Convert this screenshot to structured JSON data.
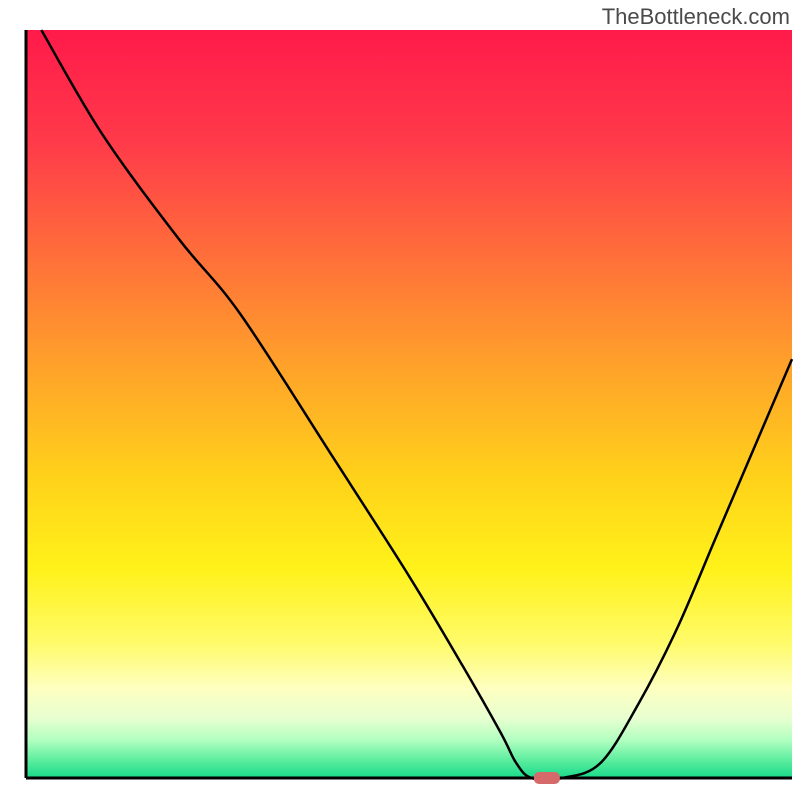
{
  "watermark": "TheBottleneck.com",
  "chart_data": {
    "type": "line",
    "title": "",
    "xlabel": "",
    "ylabel": "",
    "xlim": [
      0,
      100
    ],
    "ylim": [
      0,
      100
    ],
    "x": [
      2,
      10,
      20,
      28,
      40,
      50,
      57,
      62,
      64,
      66,
      70,
      75,
      80,
      85,
      90,
      95,
      100
    ],
    "y": [
      100,
      86,
      72,
      62,
      43,
      27,
      15,
      6,
      2,
      0,
      0,
      2,
      10,
      20,
      32,
      44,
      56
    ],
    "marker": {
      "x": 68,
      "y": 0,
      "color": "#d66a6a"
    },
    "gradient_bands": [
      {
        "offset": 0.0,
        "color": "#ff1a4a"
      },
      {
        "offset": 0.15,
        "color": "#ff3a4a"
      },
      {
        "offset": 0.3,
        "color": "#ff6e3a"
      },
      {
        "offset": 0.45,
        "color": "#ffa22a"
      },
      {
        "offset": 0.6,
        "color": "#ffd21a"
      },
      {
        "offset": 0.72,
        "color": "#fff21a"
      },
      {
        "offset": 0.82,
        "color": "#fffb6a"
      },
      {
        "offset": 0.88,
        "color": "#feffc0"
      },
      {
        "offset": 0.92,
        "color": "#e8ffd0"
      },
      {
        "offset": 0.95,
        "color": "#b0ffc0"
      },
      {
        "offset": 0.975,
        "color": "#60eea0"
      },
      {
        "offset": 1.0,
        "color": "#18da8a"
      }
    ]
  }
}
